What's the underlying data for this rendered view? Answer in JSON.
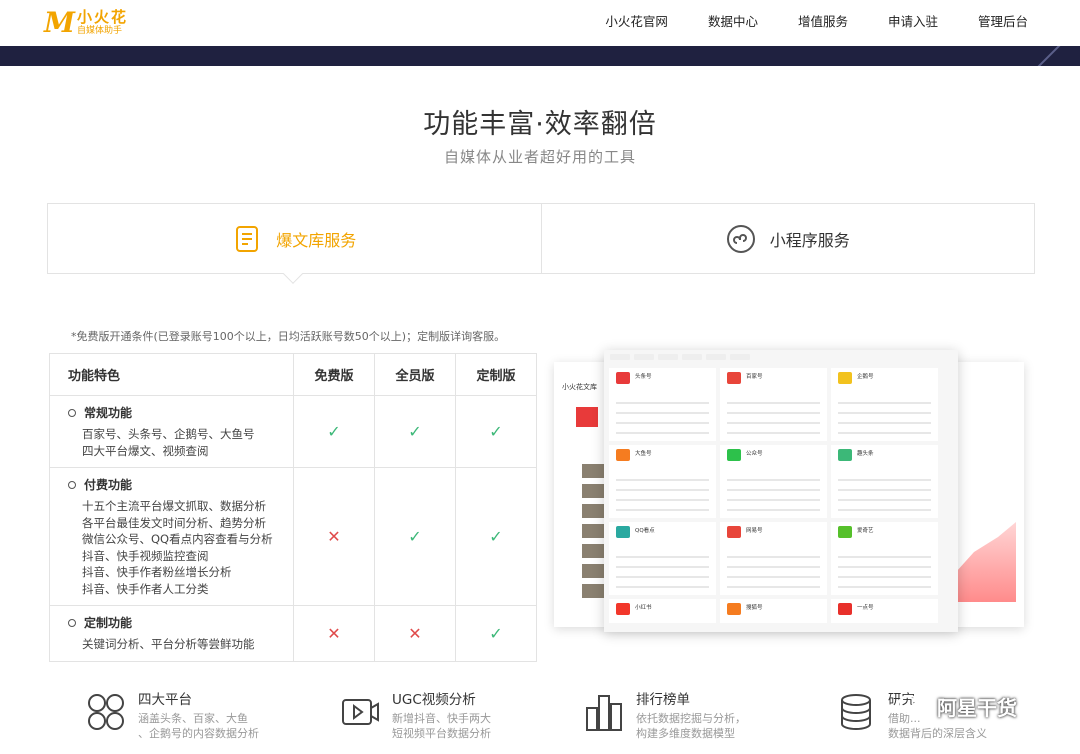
{
  "header": {
    "logo_mark": "M",
    "logo_name": "小火花",
    "logo_sub": "自媒体助手",
    "nav": [
      "小火花官网",
      "数据中心",
      "增值服务",
      "申请入驻",
      "管理后台"
    ]
  },
  "hero": {
    "title": "功能丰富·效率翻倍",
    "subtitle": "自媒体从业者超好用的工具"
  },
  "tabs": [
    {
      "label": "爆文库服务",
      "icon": "document-list-icon",
      "active": true
    },
    {
      "label": "小程序服务",
      "icon": "mini-program-icon",
      "active": false
    }
  ],
  "note": "*免费版开通条件(已登录账号100个以上，日均活跃账号数50个以上)；定制版详询客服。",
  "table": {
    "headers": [
      "功能特色",
      "免费版",
      "全员版",
      "定制版"
    ],
    "rows": [
      {
        "group": "常规功能",
        "lines": [
          "百家号、头条号、企鹅号、大鱼号",
          "四大平台爆文、视频查阅"
        ],
        "free": "check",
        "all": "check",
        "custom": "check"
      },
      {
        "group": "付费功能",
        "lines": [
          "十五个主流平台爆文抓取、数据分析",
          "各平台最佳发文时间分析、趋势分析",
          "微信公众号、QQ看点内容查看与分析",
          "抖音、快手视频监控查阅",
          "抖音、快手作者粉丝增长分析",
          "抖音、快手作者人工分类"
        ],
        "free": "cross",
        "all": "check",
        "custom": "check"
      },
      {
        "group": "定制功能",
        "lines": [
          "关键词分析、平台分析等尝鲜功能"
        ],
        "free": "cross",
        "all": "cross",
        "custom": "check"
      }
    ],
    "check_color": "#3cb878",
    "cross_color": "#e04b4b"
  },
  "mockup": {
    "side_title": "小火花文库",
    "cards": [
      {
        "name": "头条号",
        "color": "#e83a3a"
      },
      {
        "name": "百家号",
        "color": "#e8453a"
      },
      {
        "name": "企鹅号",
        "color": "#f2c21e"
      },
      {
        "name": "大鱼号",
        "color": "#f57c20"
      },
      {
        "name": "公众号",
        "color": "#2dc14b"
      },
      {
        "name": "趣头条",
        "color": "#3cb878"
      },
      {
        "name": "QQ看点",
        "color": "#2aa9a0"
      },
      {
        "name": "网易号",
        "color": "#e8453a"
      },
      {
        "name": "爱奇艺",
        "color": "#56c02b"
      },
      {
        "name": "小红书",
        "color": "#f2372b"
      },
      {
        "name": "搜狐号",
        "color": "#f57c20"
      },
      {
        "name": "一点号",
        "color": "#e8302b"
      }
    ]
  },
  "features": [
    {
      "title": "四大平台",
      "lines": [
        "涵盖头条、百家、大鱼",
        "、企鹅号的内容数据分析"
      ],
      "icon": "four-platforms-icon"
    },
    {
      "title": "UGC视频分析",
      "lines": [
        "新增抖音、快手两大",
        "短视频平台数据分析"
      ],
      "icon": "video-play-icon"
    },
    {
      "title": "排行榜单",
      "lines": [
        "依托数据挖掘与分析，",
        "构建多维度数据模型"
      ],
      "icon": "ranking-icon"
    },
    {
      "title": "研究",
      "lines": [
        "借助...",
        "数据背后的深层含义"
      ],
      "icon": "database-icon"
    }
  ],
  "watermark": "阿星干货",
  "colors": {
    "accent": "#f2a400",
    "band": "#1f2140"
  }
}
